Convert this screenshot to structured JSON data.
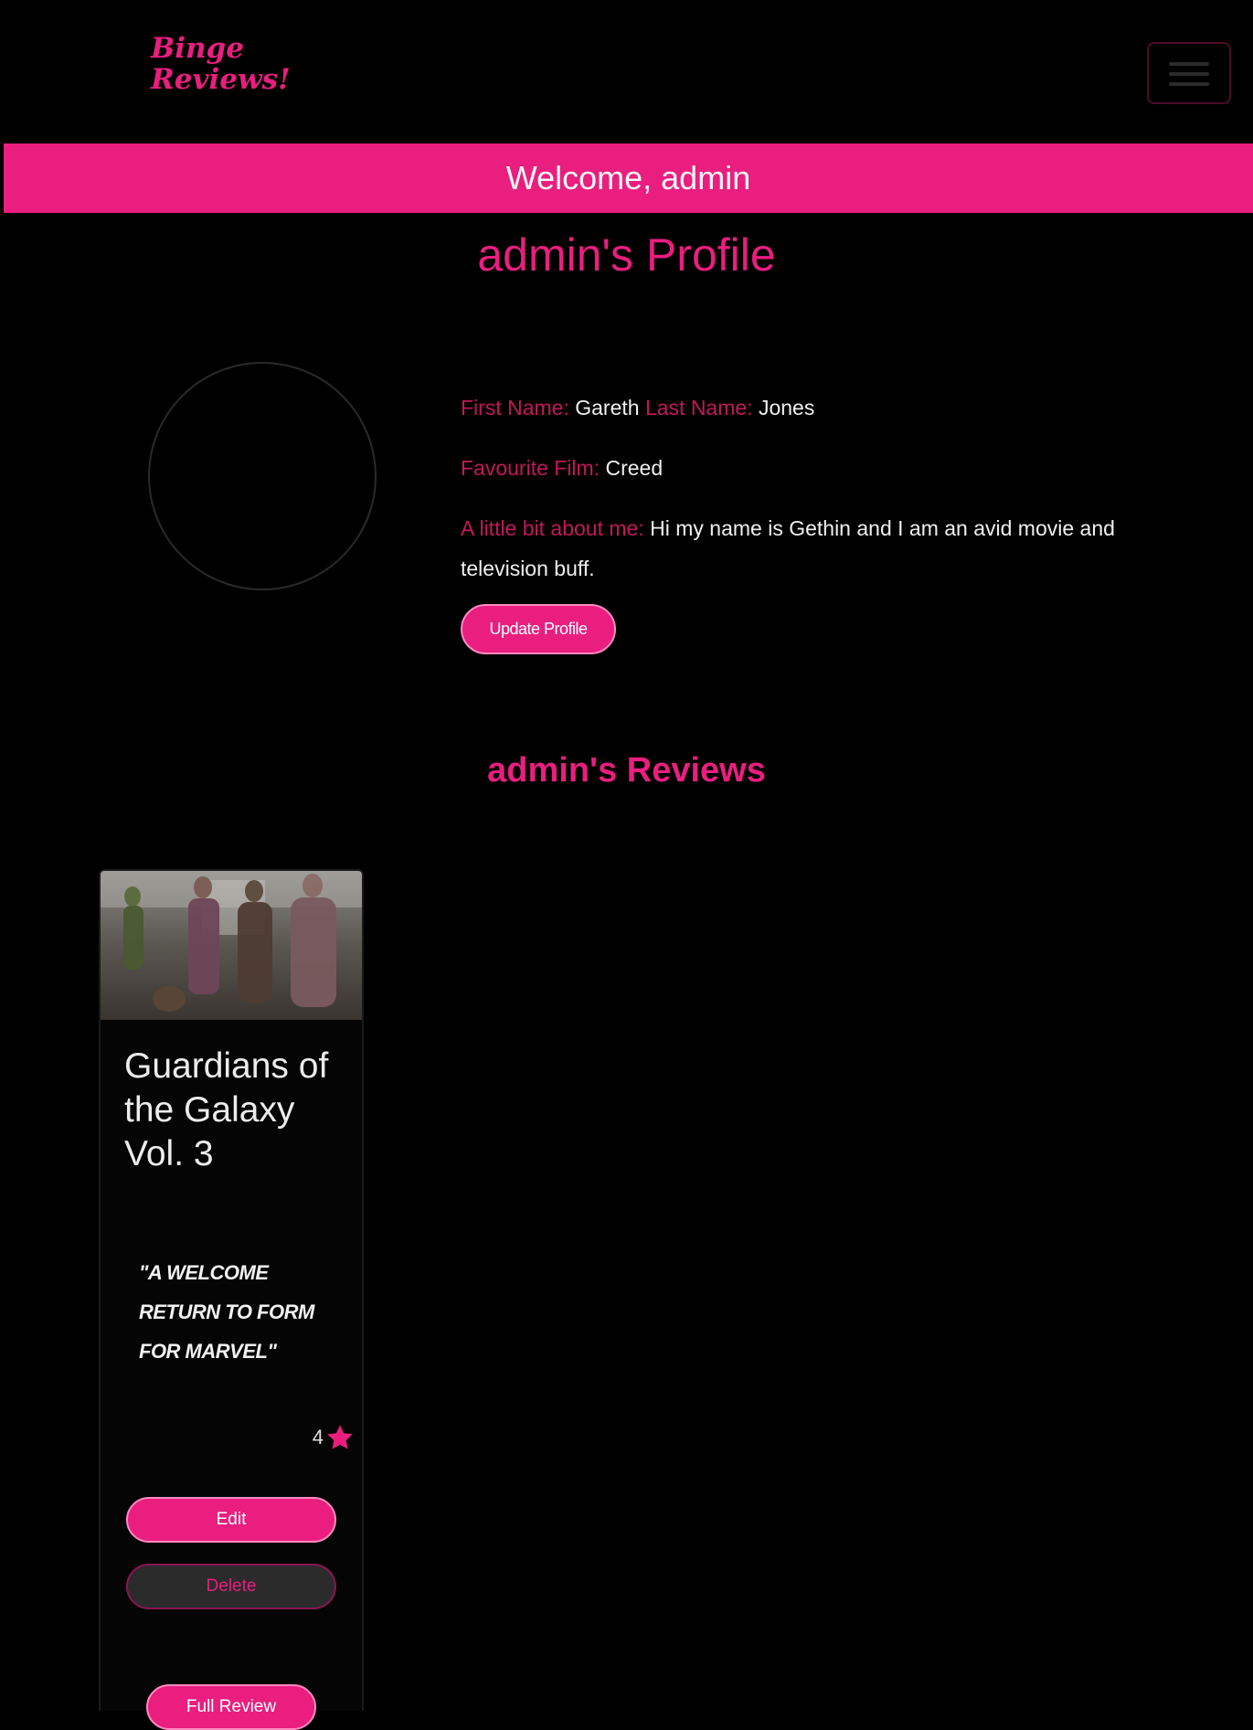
{
  "navbar": {
    "brand_line1": "Binge",
    "brand_line2": "Reviews!",
    "menu_icon": "hamburger-icon"
  },
  "banner": {
    "welcome": "Welcome, admin"
  },
  "profile": {
    "title": "admin's Profile",
    "first_name_label": "First Name:",
    "first_name": "Gareth",
    "last_name_label": "Last Name:",
    "last_name": "Jones",
    "favourite_film_label": "Favourite Film:",
    "favourite_film": "Creed",
    "about_label": "A little bit about me:",
    "about": "Hi my name is Gethin and I am an avid movie and television buff.",
    "update_button": "Update Profile"
  },
  "reviews": {
    "title": "admin's Reviews",
    "items": [
      {
        "title": "Guardians of the Galaxy Vol. 3",
        "quote": "\"A WELCOME RETURN TO FORM FOR MARVEL\"",
        "rating": "4",
        "edit_button": "Edit",
        "delete_button": "Delete",
        "full_review_button": "Full Review"
      }
    ]
  },
  "colors": {
    "accent": "#e91e7f",
    "label": "#c2185b",
    "background": "#000000"
  }
}
